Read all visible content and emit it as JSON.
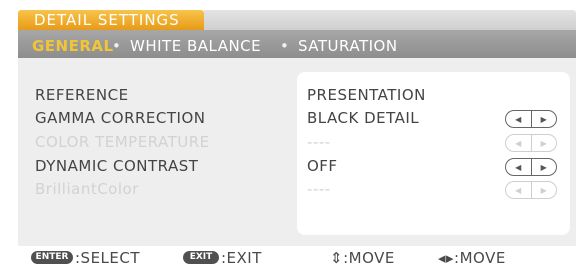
{
  "menu": {
    "title": "DETAIL SETTINGS"
  },
  "tabs": {
    "general": "GENERAL",
    "white_balance": "WHITE BALANCE",
    "saturation": "SATURATION",
    "separator": "•"
  },
  "rows": [
    {
      "label": "REFERENCE",
      "value": "PRESENTATION",
      "enabled": true,
      "has_stepper": false
    },
    {
      "label": "GAMMA CORRECTION",
      "value": "BLACK DETAIL",
      "enabled": true,
      "has_stepper": true
    },
    {
      "label": "COLOR TEMPERATURE",
      "value": "----",
      "enabled": false,
      "has_stepper": true
    },
    {
      "label": "DYNAMIC CONTRAST",
      "value": "OFF",
      "enabled": true,
      "has_stepper": true
    },
    {
      "label": "BrilliantColor",
      "value": "----",
      "enabled": false,
      "has_stepper": true
    }
  ],
  "stepper": {
    "left": "◀",
    "right": "▶"
  },
  "footer": {
    "enter_key": "ENTER",
    "enter_action": ":SELECT",
    "exit_key": "EXIT",
    "exit_action": ":EXIT",
    "move_vertical": "⇕:MOVE",
    "move_horizontal": "◂▸:MOVE"
  },
  "colors": {
    "accent": "#f2c535",
    "title_bg": "#e9a21f",
    "tab_bar": "#999999",
    "panel_bg": "#eeeeee"
  }
}
